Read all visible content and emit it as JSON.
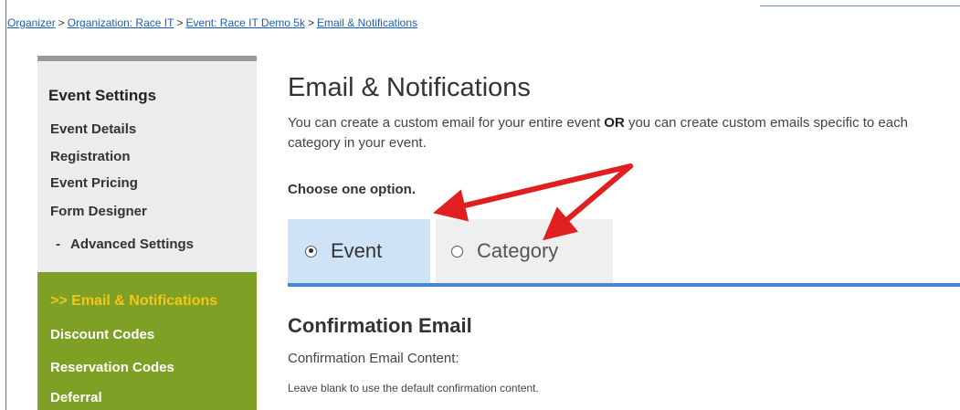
{
  "breadcrumb": {
    "items": [
      "Organizer",
      "Organization: Race IT",
      "Event: Race IT Demo 5k",
      "Email & Notifications"
    ],
    "separator": ">"
  },
  "sidebar": {
    "heading": "Event Settings",
    "items": [
      {
        "label": "Event Details"
      },
      {
        "label": "Registration"
      },
      {
        "label": "Event Pricing"
      },
      {
        "label": "Form Designer"
      },
      {
        "label": "Advanced Settings",
        "prefix": "-"
      },
      {
        "label": "Email & Notifications",
        "prefix": ">>",
        "active": true
      },
      {
        "label": "Discount Codes"
      },
      {
        "label": "Reservation Codes"
      },
      {
        "label": "Deferral"
      }
    ]
  },
  "main": {
    "title": "Email & Notifications",
    "description_part1": "You can create a custom email for your entire event ",
    "description_bold": "OR",
    "description_part2": " you can create custom emails specific to each category in your event.",
    "choose_label": "Choose one option.",
    "tabs": [
      {
        "label": "Event",
        "selected": true
      },
      {
        "label": "Category",
        "selected": false
      }
    ],
    "section_title": "Confirmation Email",
    "content_label": "Confirmation Email Content:",
    "hint": "Leave blank to use the default confirmation content."
  },
  "colors": {
    "link": "#1a5fb4",
    "sidebar_green": "#7ea125",
    "sidebar_active": "#f5c518",
    "tab_selected": "#cfe3f7",
    "tab_underline": "#4a86cf",
    "arrow": "#e02020"
  }
}
